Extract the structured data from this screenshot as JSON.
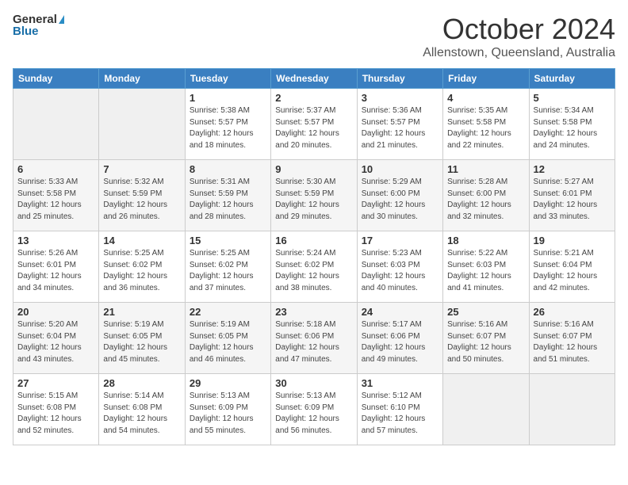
{
  "header": {
    "logo_general": "General",
    "logo_blue": "Blue",
    "month_title": "October 2024",
    "subtitle": "Allenstown, Queensland, Australia"
  },
  "days_of_week": [
    "Sunday",
    "Monday",
    "Tuesday",
    "Wednesday",
    "Thursday",
    "Friday",
    "Saturday"
  ],
  "weeks": [
    [
      {
        "day": "",
        "info": ""
      },
      {
        "day": "",
        "info": ""
      },
      {
        "day": "1",
        "info": "Sunrise: 5:38 AM\nSunset: 5:57 PM\nDaylight: 12 hours and 18 minutes."
      },
      {
        "day": "2",
        "info": "Sunrise: 5:37 AM\nSunset: 5:57 PM\nDaylight: 12 hours and 20 minutes."
      },
      {
        "day": "3",
        "info": "Sunrise: 5:36 AM\nSunset: 5:57 PM\nDaylight: 12 hours and 21 minutes."
      },
      {
        "day": "4",
        "info": "Sunrise: 5:35 AM\nSunset: 5:58 PM\nDaylight: 12 hours and 22 minutes."
      },
      {
        "day": "5",
        "info": "Sunrise: 5:34 AM\nSunset: 5:58 PM\nDaylight: 12 hours and 24 minutes."
      }
    ],
    [
      {
        "day": "6",
        "info": "Sunrise: 5:33 AM\nSunset: 5:58 PM\nDaylight: 12 hours and 25 minutes."
      },
      {
        "day": "7",
        "info": "Sunrise: 5:32 AM\nSunset: 5:59 PM\nDaylight: 12 hours and 26 minutes."
      },
      {
        "day": "8",
        "info": "Sunrise: 5:31 AM\nSunset: 5:59 PM\nDaylight: 12 hours and 28 minutes."
      },
      {
        "day": "9",
        "info": "Sunrise: 5:30 AM\nSunset: 5:59 PM\nDaylight: 12 hours and 29 minutes."
      },
      {
        "day": "10",
        "info": "Sunrise: 5:29 AM\nSunset: 6:00 PM\nDaylight: 12 hours and 30 minutes."
      },
      {
        "day": "11",
        "info": "Sunrise: 5:28 AM\nSunset: 6:00 PM\nDaylight: 12 hours and 32 minutes."
      },
      {
        "day": "12",
        "info": "Sunrise: 5:27 AM\nSunset: 6:01 PM\nDaylight: 12 hours and 33 minutes."
      }
    ],
    [
      {
        "day": "13",
        "info": "Sunrise: 5:26 AM\nSunset: 6:01 PM\nDaylight: 12 hours and 34 minutes."
      },
      {
        "day": "14",
        "info": "Sunrise: 5:25 AM\nSunset: 6:02 PM\nDaylight: 12 hours and 36 minutes."
      },
      {
        "day": "15",
        "info": "Sunrise: 5:25 AM\nSunset: 6:02 PM\nDaylight: 12 hours and 37 minutes."
      },
      {
        "day": "16",
        "info": "Sunrise: 5:24 AM\nSunset: 6:02 PM\nDaylight: 12 hours and 38 minutes."
      },
      {
        "day": "17",
        "info": "Sunrise: 5:23 AM\nSunset: 6:03 PM\nDaylight: 12 hours and 40 minutes."
      },
      {
        "day": "18",
        "info": "Sunrise: 5:22 AM\nSunset: 6:03 PM\nDaylight: 12 hours and 41 minutes."
      },
      {
        "day": "19",
        "info": "Sunrise: 5:21 AM\nSunset: 6:04 PM\nDaylight: 12 hours and 42 minutes."
      }
    ],
    [
      {
        "day": "20",
        "info": "Sunrise: 5:20 AM\nSunset: 6:04 PM\nDaylight: 12 hours and 43 minutes."
      },
      {
        "day": "21",
        "info": "Sunrise: 5:19 AM\nSunset: 6:05 PM\nDaylight: 12 hours and 45 minutes."
      },
      {
        "day": "22",
        "info": "Sunrise: 5:19 AM\nSunset: 6:05 PM\nDaylight: 12 hours and 46 minutes."
      },
      {
        "day": "23",
        "info": "Sunrise: 5:18 AM\nSunset: 6:06 PM\nDaylight: 12 hours and 47 minutes."
      },
      {
        "day": "24",
        "info": "Sunrise: 5:17 AM\nSunset: 6:06 PM\nDaylight: 12 hours and 49 minutes."
      },
      {
        "day": "25",
        "info": "Sunrise: 5:16 AM\nSunset: 6:07 PM\nDaylight: 12 hours and 50 minutes."
      },
      {
        "day": "26",
        "info": "Sunrise: 5:16 AM\nSunset: 6:07 PM\nDaylight: 12 hours and 51 minutes."
      }
    ],
    [
      {
        "day": "27",
        "info": "Sunrise: 5:15 AM\nSunset: 6:08 PM\nDaylight: 12 hours and 52 minutes."
      },
      {
        "day": "28",
        "info": "Sunrise: 5:14 AM\nSunset: 6:08 PM\nDaylight: 12 hours and 54 minutes."
      },
      {
        "day": "29",
        "info": "Sunrise: 5:13 AM\nSunset: 6:09 PM\nDaylight: 12 hours and 55 minutes."
      },
      {
        "day": "30",
        "info": "Sunrise: 5:13 AM\nSunset: 6:09 PM\nDaylight: 12 hours and 56 minutes."
      },
      {
        "day": "31",
        "info": "Sunrise: 5:12 AM\nSunset: 6:10 PM\nDaylight: 12 hours and 57 minutes."
      },
      {
        "day": "",
        "info": ""
      },
      {
        "day": "",
        "info": ""
      }
    ]
  ]
}
